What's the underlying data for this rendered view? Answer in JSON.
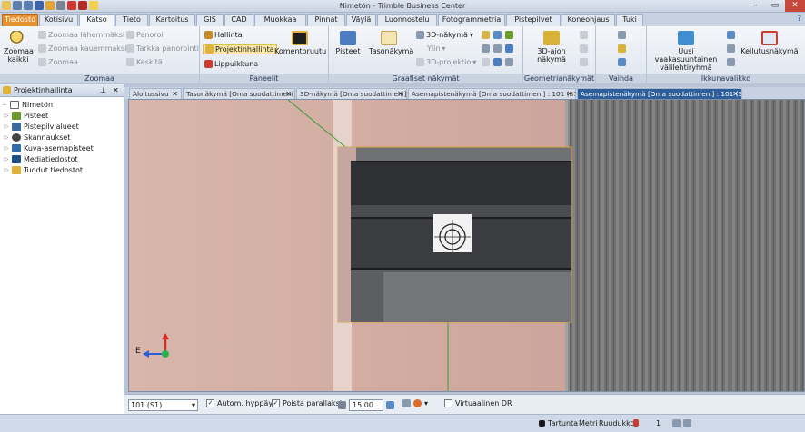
{
  "app": {
    "title": "Nimetön - Trimble Business Center",
    "help_label": "?"
  },
  "ribbon_tabs": [
    {
      "label": "Tiedosto"
    },
    {
      "label": "Kotisivu"
    },
    {
      "label": "Katso"
    },
    {
      "label": "Tieto"
    },
    {
      "label": "Kartoitus"
    },
    {
      "label": "GIS"
    },
    {
      "label": "CAD"
    },
    {
      "label": "Muokkaa"
    },
    {
      "label": "Pinnat"
    },
    {
      "label": "Väylä"
    },
    {
      "label": "Luonnostelu"
    },
    {
      "label": "Fotogrammetria"
    },
    {
      "label": "Pistepilvet"
    },
    {
      "label": "Koneohjaus"
    },
    {
      "label": "Tuki"
    }
  ],
  "ribbon": {
    "zoomaa": {
      "label": "Zoomaa",
      "zoomaa_kaikki": "Zoomaa kaikki",
      "lahemmaksi": "Zoomaa lähemmäksi",
      "kauemmaksi": "Zoomaa kauemmaksi",
      "zoomaa": "Zoomaa",
      "panoroi": "Panoroi",
      "tarkka": "Tarkka panorointi",
      "keskita": "Keskitä"
    },
    "paneelit": {
      "label": "Paneelit",
      "hallinta": "Hallinta",
      "projektinhallinta": "Projektinhallinta",
      "lippuikkuna": "Lippuikkuna",
      "komentoruutu": "Komentoruutu"
    },
    "graafiset": {
      "label": "Graafiset näkymät",
      "pisteet": "Pisteet",
      "tasonakyma": "Tasonäkymä",
      "nakyma3d": "3D-näkymä",
      "ylin": "Ylin",
      "projektio": "3D-projektio"
    },
    "geometria": {
      "label": "Geometrianäkymät",
      "ajon": "3D-ajon näkymä"
    },
    "vaihda": {
      "label": "Vaihda"
    },
    "ikkuna": {
      "label": "Ikkunavalikko",
      "uusi": "Uusi vaakasuuntainen välilehtiryhmä",
      "kellutus": "Kellutusnäkymä"
    }
  },
  "project_panel": {
    "title": "Projektinhallinta",
    "root": "Nimetön",
    "items": [
      {
        "label": "Pisteet",
        "color": "#6a9a2a"
      },
      {
        "label": "Pistepilvialueet",
        "color": "#3a6aa0"
      },
      {
        "label": "Skannaukset",
        "color": "#444444"
      },
      {
        "label": "Kuva-asemapisteet",
        "color": "#2f6db0"
      },
      {
        "label": "Mediatiedostot",
        "color": "#1f4f8a"
      },
      {
        "label": "Tuodut tiedostot",
        "color": "#e0b23a"
      }
    ]
  },
  "view_tabs": [
    {
      "label": "Aloitussivu",
      "active": false
    },
    {
      "label": "Tasonäkymä [Oma suodattimeni]",
      "active": false
    },
    {
      "label": "3D-näkymä [Oma suodattimeni]",
      "active": false
    },
    {
      "label": "Asemapistenäkymä [Oma suodattimeni] : 101 (S1)",
      "active": false
    },
    {
      "label": "Asemapistenäkymä [Oma suodattimeni] : 101 (S1)",
      "active": true
    }
  ],
  "viewport": {
    "axis_label": "E"
  },
  "options_bar": {
    "station": "101 (S1)",
    "autom_hyppays": "Autom. hyppäys",
    "autom_checked": true,
    "poista_parallaksi": "Poista parallaksi",
    "poista_checked": true,
    "value": "15.00",
    "virtuaalinen": "Virtuaalinen DR",
    "virtuaalinen_checked": false
  },
  "status": {
    "tartunta": "Tartunta",
    "metri": "Metri",
    "ruudukko": "Ruudukko",
    "count": "1"
  }
}
